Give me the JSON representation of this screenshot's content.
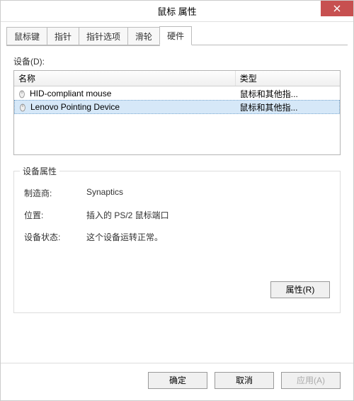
{
  "window": {
    "title": "鼠标 属性"
  },
  "tabs": [
    {
      "label": "鼠标键",
      "active": false
    },
    {
      "label": "指针",
      "active": false
    },
    {
      "label": "指针选项",
      "active": false
    },
    {
      "label": "滑轮",
      "active": false
    },
    {
      "label": "硬件",
      "active": true
    }
  ],
  "device_section": {
    "label": "设备(D):",
    "columns": {
      "name": "名称",
      "type": "类型"
    },
    "rows": [
      {
        "name": "HID-compliant mouse",
        "type": "鼠标和其他指...",
        "selected": false
      },
      {
        "name": "Lenovo Pointing Device",
        "type": "鼠标和其他指...",
        "selected": true
      }
    ]
  },
  "properties": {
    "group_title": "设备属性",
    "manufacturer_label": "制造商:",
    "manufacturer_value": "Synaptics",
    "location_label": "位置:",
    "location_value": "插入的 PS/2 鼠标端口",
    "status_label": "设备状态:",
    "status_value": "这个设备运转正常。",
    "properties_button": "属性(R)"
  },
  "dialog_buttons": {
    "ok": "确定",
    "cancel": "取消",
    "apply": "应用(A)"
  }
}
